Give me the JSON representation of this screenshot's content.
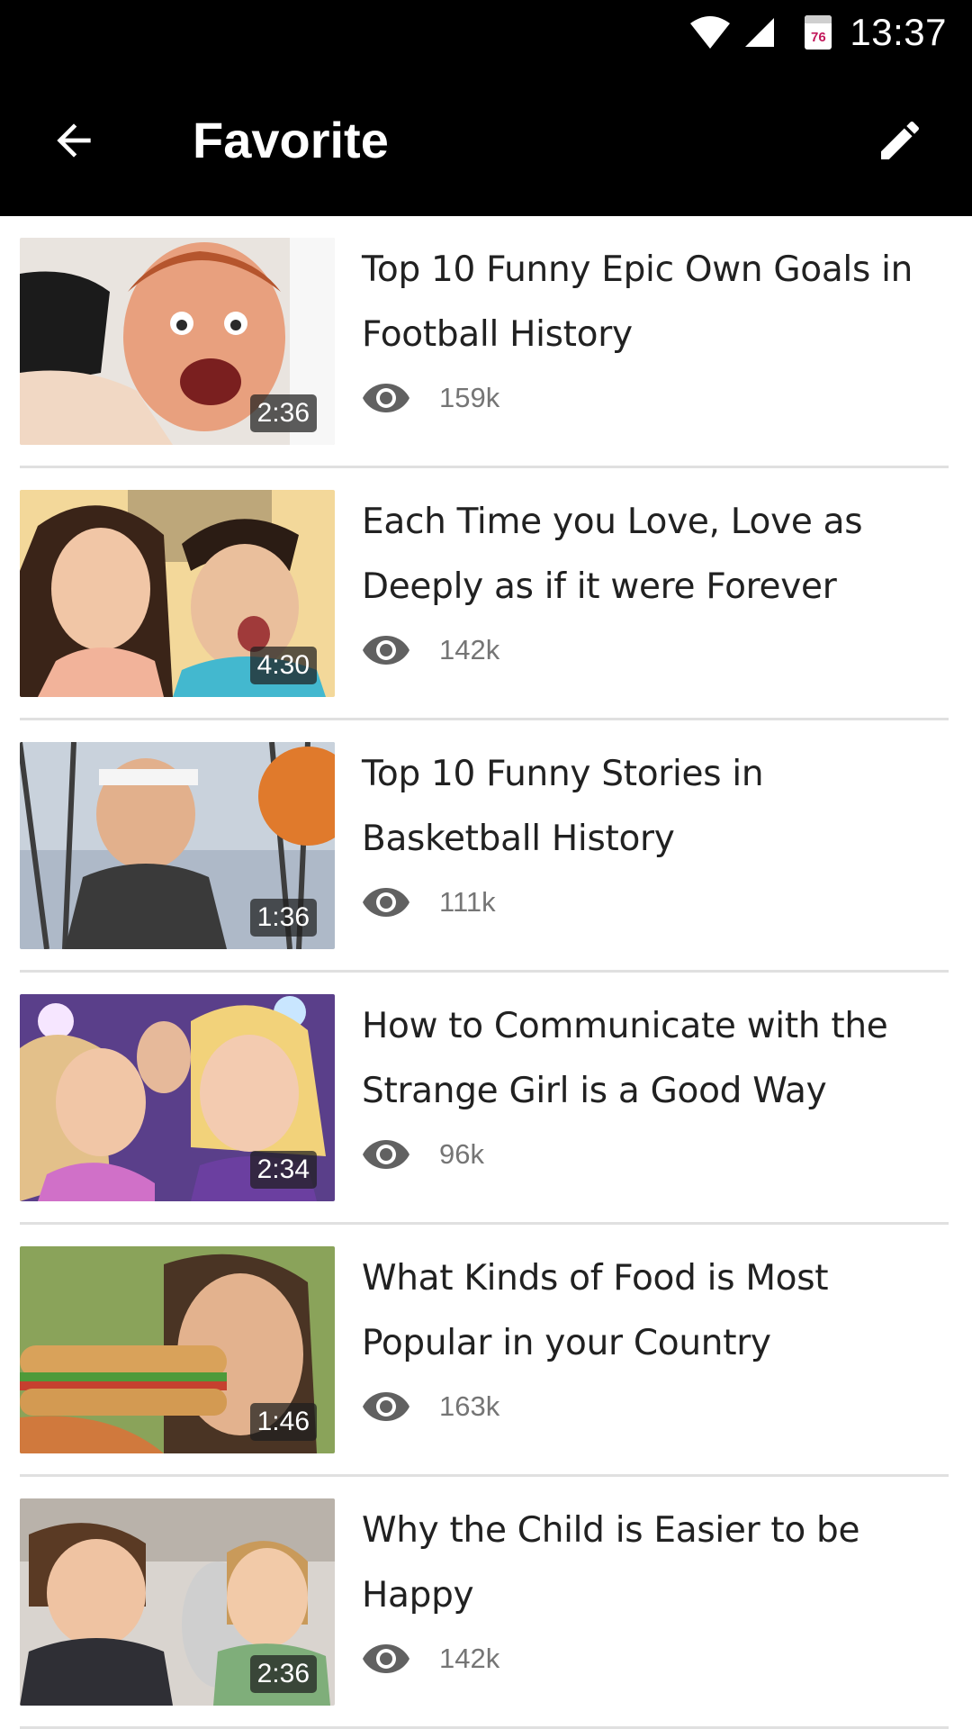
{
  "status_bar": {
    "time": "13:37",
    "calendar_day": "76",
    "icons": [
      "wifi-icon",
      "signal-icon",
      "calendar-icon"
    ]
  },
  "app_bar": {
    "title": "Favorite",
    "back_icon": "arrow-back-icon",
    "edit_icon": "pencil-icon"
  },
  "videos": [
    {
      "title": "Top 10 Funny Epic Own Goals in Football History",
      "duration": "2:36",
      "views": "159k"
    },
    {
      "title": "Each Time you Love, Love as Deeply as if it were Forever",
      "duration": "4:30",
      "views": "142k"
    },
    {
      "title": "Top 10 Funny Stories in Basketball History",
      "duration": "1:36",
      "views": "111k"
    },
    {
      "title": "How to Communicate with the Strange Girl is a Good Way",
      "duration": "2:34",
      "views": "96k"
    },
    {
      "title": "What Kinds of Food is Most Popular in your Country",
      "duration": "1:46",
      "views": "163k"
    },
    {
      "title": "Why the Child is Easier to be Happy",
      "duration": "2:36",
      "views": "142k"
    }
  ],
  "colors": {
    "app_bar": "#000000",
    "divider": "#e0e0e0",
    "title_text": "#212121",
    "meta_text": "#757575"
  }
}
